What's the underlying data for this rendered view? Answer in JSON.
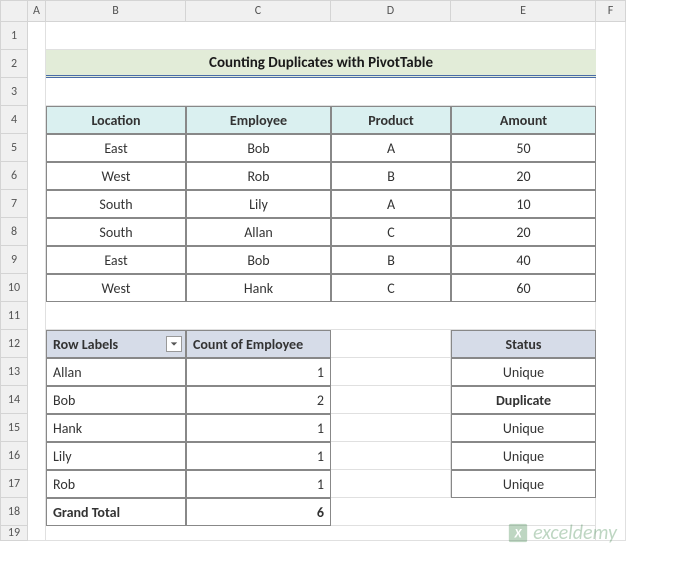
{
  "columns": [
    "A",
    "B",
    "C",
    "D",
    "E",
    "F"
  ],
  "rows": [
    "1",
    "2",
    "3",
    "4",
    "5",
    "6",
    "7",
    "8",
    "9",
    "10",
    "11",
    "12",
    "13",
    "14",
    "15",
    "16",
    "17",
    "18",
    "19"
  ],
  "title": "Counting Duplicates with PivotTable",
  "table1": {
    "headers": [
      "Location",
      "Employee",
      "Product",
      "Amount"
    ],
    "rows": [
      [
        "East",
        "Bob",
        "A",
        "50"
      ],
      [
        "West",
        "Rob",
        "B",
        "20"
      ],
      [
        "South",
        "Lily",
        "A",
        "10"
      ],
      [
        "South",
        "Allan",
        "C",
        "20"
      ],
      [
        "East",
        "Bob",
        "B",
        "40"
      ],
      [
        "West",
        "Hank",
        "C",
        "60"
      ]
    ]
  },
  "pivot": {
    "rowLabelsHeader": "Row Labels",
    "countHeader": "Count of Employee",
    "statusHeader": "Status",
    "rows": [
      {
        "name": "Allan",
        "count": "1",
        "status": "Unique"
      },
      {
        "name": "Bob",
        "count": "2",
        "status": "Duplicate"
      },
      {
        "name": "Hank",
        "count": "1",
        "status": "Unique"
      },
      {
        "name": "Lily",
        "count": "1",
        "status": "Unique"
      },
      {
        "name": "Rob",
        "count": "1",
        "status": "Unique"
      }
    ],
    "grandTotalLabel": "Grand Total",
    "grandTotalValue": "6"
  },
  "watermark": "exceldemy"
}
